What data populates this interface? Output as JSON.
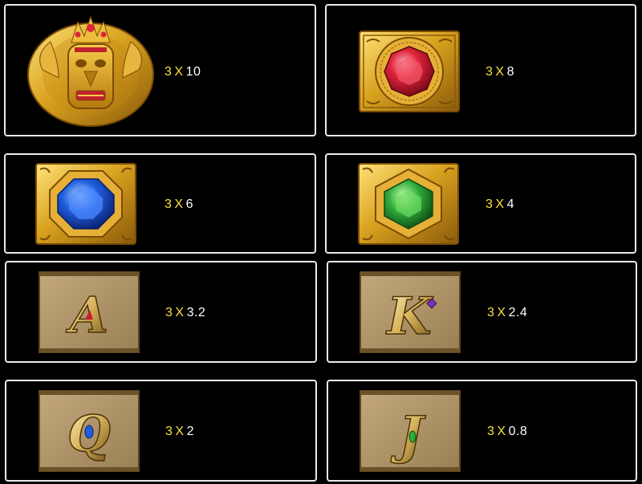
{
  "paytable": [
    {
      "symbol": "garuda-ring-icon",
      "count": "3",
      "times": "X",
      "multiplier": "10"
    },
    {
      "symbol": "red-ruby-icon",
      "count": "3",
      "times": "X",
      "multiplier": "8"
    },
    {
      "symbol": "blue-sapphire-icon",
      "count": "3",
      "times": "X",
      "multiplier": "6"
    },
    {
      "symbol": "green-emerald-icon",
      "count": "3",
      "times": "X",
      "multiplier": "4"
    },
    {
      "symbol": "letter-a-icon",
      "count": "3",
      "times": "X",
      "multiplier": "3.2",
      "letter": "A"
    },
    {
      "symbol": "letter-k-icon",
      "count": "3",
      "times": "X",
      "multiplier": "2.4",
      "letter": "K"
    },
    {
      "symbol": "letter-q-icon",
      "count": "3",
      "times": "X",
      "multiplier": "2",
      "letter": "Q"
    },
    {
      "symbol": "letter-j-icon",
      "count": "3",
      "times": "X",
      "multiplier": "0.8",
      "letter": "J"
    }
  ],
  "colors": {
    "gold": "#d9a21f",
    "gold_dark": "#8a5a0a",
    "parchment": "#b49a70",
    "count_yellow": "#f7e13b",
    "ruby": "#e0243a",
    "sapphire": "#1f5fe0",
    "emerald": "#2fae3a"
  }
}
